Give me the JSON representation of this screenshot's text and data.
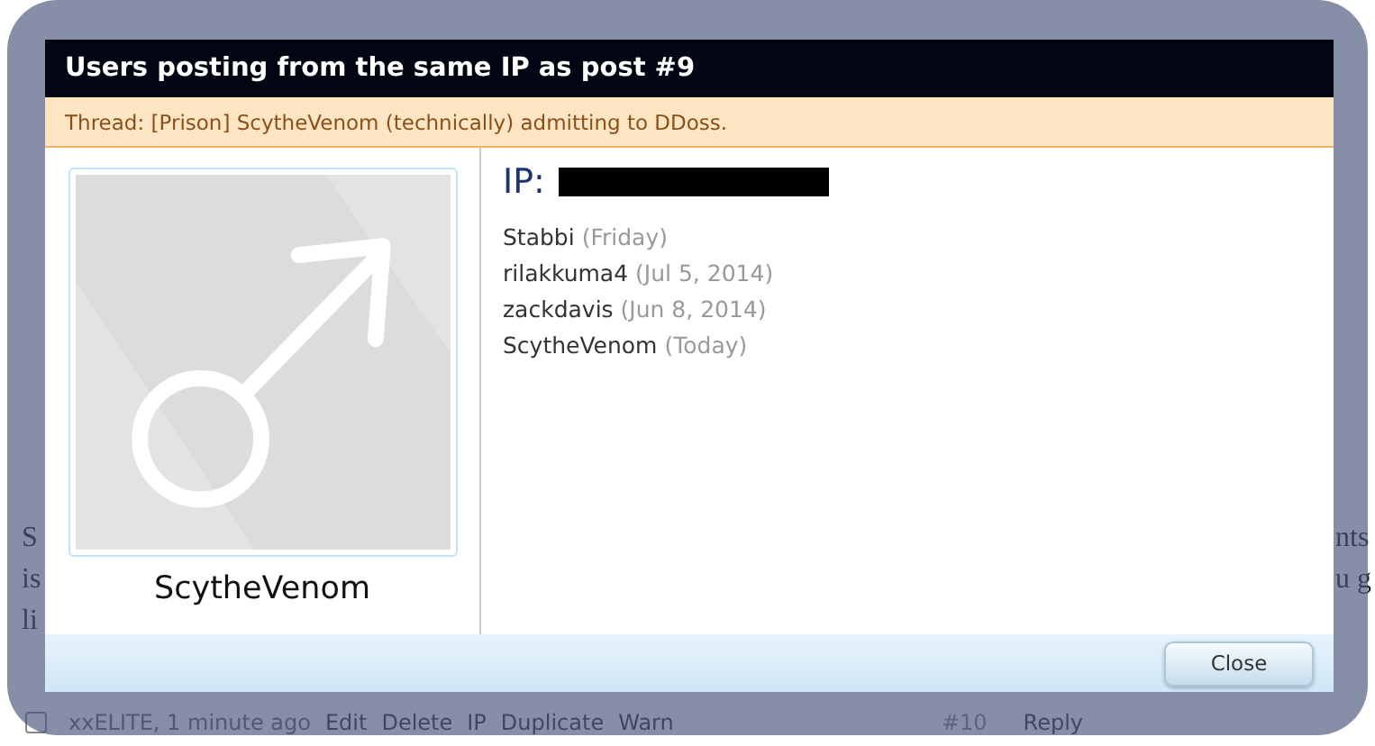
{
  "background_page": {
    "post_text_left": [
      "S",
      "is",
      "li"
    ],
    "post_text_right": [
      "nts",
      "u g"
    ],
    "post_footer": {
      "checked": false,
      "author_time": "xxELITE, 1 minute ago",
      "actions": [
        "Edit",
        "Delete",
        "IP",
        "Duplicate",
        "Warn"
      ],
      "post_number": "#10",
      "reply": "Reply"
    }
  },
  "dialog": {
    "title": "Users posting from the same IP as post #9",
    "thread": "Thread: [Prison] ScytheVenom (technically) admitting to DDoss.",
    "user": {
      "name": "ScytheVenom"
    },
    "ip_label": "IP:",
    "users": [
      {
        "name": "Stabbi",
        "when": "(Friday)"
      },
      {
        "name": "rilakkuma4",
        "when": "(Jul 5, 2014)"
      },
      {
        "name": "zackdavis",
        "when": "(Jun 8, 2014)"
      },
      {
        "name": "ScytheVenom",
        "when": "(Today)"
      }
    ],
    "buttons": [
      "Close"
    ]
  }
}
